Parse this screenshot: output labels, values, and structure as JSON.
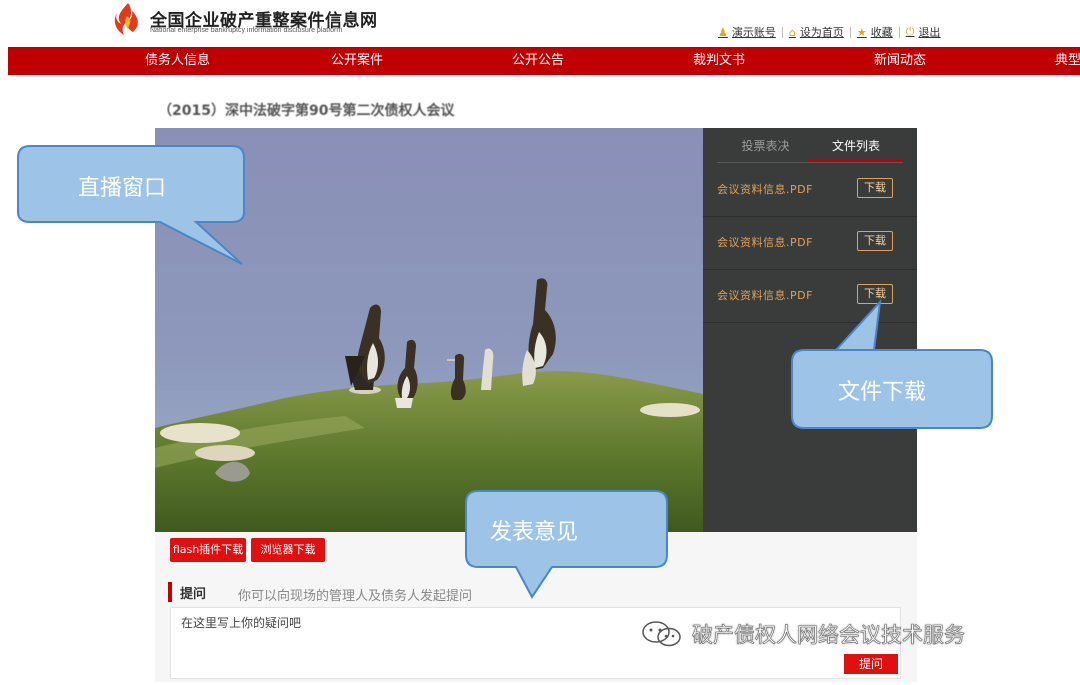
{
  "header": {
    "site_title": "全国企业破产重整案件信息网",
    "site_subtitle": "National enterprise bankruptcy information disclosure platform",
    "user_links": [
      {
        "icon": "user-icon",
        "label": "演示账号"
      },
      {
        "icon": "home-icon",
        "label": "设为首页"
      },
      {
        "icon": "star-icon",
        "label": "收藏"
      },
      {
        "icon": "power-icon",
        "label": "退出"
      }
    ]
  },
  "nav": {
    "items": [
      "债务人信息",
      "公开案件",
      "公开公告",
      "裁判文书",
      "新闻动态",
      "典型"
    ]
  },
  "meeting": {
    "title": "（2015）深中法破字第90号第二次债权人会议"
  },
  "side_panel": {
    "tabs": [
      "投票表决",
      "文件列表"
    ],
    "active_tab": "文件列表",
    "files": [
      {
        "name": "会议资料信息.PDF",
        "action": "下载"
      },
      {
        "name": "会议资料信息.PDF",
        "action": "下载"
      },
      {
        "name": "会议资料信息.PDF",
        "action": "下载"
      }
    ]
  },
  "plugins": {
    "flash_label": "flash插件下载",
    "browser_label": "浏览器下载"
  },
  "question": {
    "label": "提问",
    "hint": "你可以向现场的管理人及债务人发起提问",
    "placeholder": "在这里写上你的疑问吧",
    "submit_label": "提问"
  },
  "callouts": {
    "live_window": "直播窗口",
    "file_download": "文件下载",
    "post_comment": "发表意见"
  },
  "watermark": {
    "text": "破产债权人网络会议技术服务"
  },
  "colors": {
    "brand_red": "#c00000",
    "panel_dark": "#3a3c3b",
    "file_orange": "#e0a25a",
    "callout_fill": "#9dc3e6",
    "callout_stroke": "#4a86c8"
  }
}
